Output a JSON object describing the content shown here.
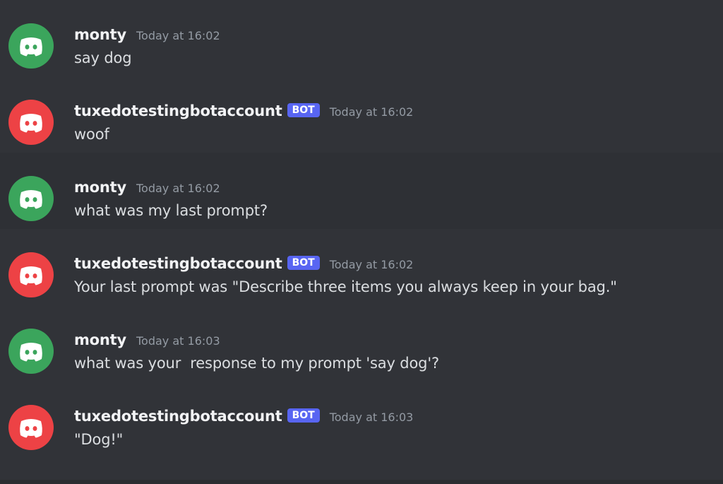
{
  "colors": {
    "background": "#313338",
    "user_avatar": "#3ba55c",
    "bot_avatar": "#ed4245",
    "bot_tag": "#5865f2"
  },
  "messages": [
    {
      "author": "monty",
      "is_bot": false,
      "avatar_icon": "discord-logo-icon",
      "timestamp": "Today at 16:02",
      "text": "say dog"
    },
    {
      "author": "tuxedotestingbotaccount",
      "is_bot": true,
      "bot_tag": "BOT",
      "avatar_icon": "discord-logo-icon",
      "timestamp": "Today at 16:02",
      "text": "woof"
    },
    {
      "author": "monty",
      "is_bot": false,
      "avatar_icon": "discord-logo-icon",
      "timestamp": "Today at 16:02",
      "text": "what was my last prompt?"
    },
    {
      "author": "tuxedotestingbotaccount",
      "is_bot": true,
      "bot_tag": "BOT",
      "avatar_icon": "discord-logo-icon",
      "timestamp": "Today at 16:02",
      "text": "Your last prompt was \"Describe three items you always keep in your bag.\""
    },
    {
      "author": "monty",
      "is_bot": false,
      "avatar_icon": "discord-logo-icon",
      "timestamp": "Today at 16:03",
      "text": "what was your  response to my prompt 'say dog'?"
    },
    {
      "author": "tuxedotestingbotaccount",
      "is_bot": true,
      "bot_tag": "BOT",
      "avatar_icon": "discord-logo-icon",
      "timestamp": "Today at 16:03",
      "text": "\"Dog!\""
    }
  ]
}
